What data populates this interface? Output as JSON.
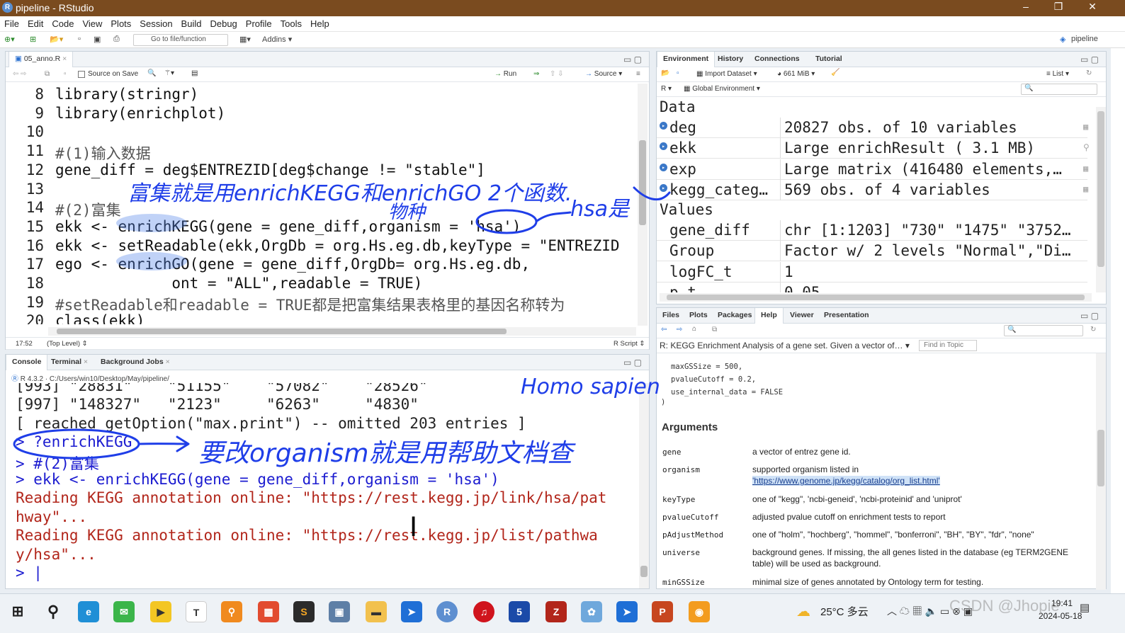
{
  "window": {
    "title": "pipeline - RStudio",
    "project": "pipeline"
  },
  "menu": [
    "File",
    "Edit",
    "Code",
    "View",
    "Plots",
    "Session",
    "Build",
    "Debug",
    "Profile",
    "Tools",
    "Help"
  ],
  "toolbar": {
    "goto_placeholder": "Go to file/function",
    "addins": "Addins"
  },
  "editor": {
    "tab": "05_anno.R",
    "source_on_save": "Source on Save",
    "run": "Run",
    "source": "Source",
    "lines": [
      {
        "n": "8",
        "text": "library(stringr)"
      },
      {
        "n": "9",
        "text": "library(enrichplot)"
      },
      {
        "n": "10",
        "text": ""
      },
      {
        "n": "11",
        "text": "#(1)输入数据"
      },
      {
        "n": "12",
        "text": "gene_diff = deg$ENTREZID[deg$change != \"stable\"]"
      },
      {
        "n": "13",
        "text": ""
      },
      {
        "n": "14",
        "text": "#(2)富集"
      },
      {
        "n": "15",
        "text": "ekk <- enrichKEGG(gene = gene_diff,organism = 'hsa')"
      },
      {
        "n": "16",
        "text": "ekk <- setReadable(ekk,OrgDb = org.Hs.eg.db,keyType = \"ENTREZID"
      },
      {
        "n": "17",
        "text": "ego <- enrichGO(gene = gene_diff,OrgDb= org.Hs.eg.db,"
      },
      {
        "n": "18",
        "text": "             ont = \"ALL\",readable = TRUE)"
      },
      {
        "n": "19",
        "text": "#setReadable和readable = TRUE都是把富集结果表格里的基因名称转为"
      },
      {
        "n": "20",
        "text": "class(ekk)"
      },
      {
        "n": "21",
        "text": ""
      }
    ],
    "status_pos": "17:52",
    "status_scope": "(Top Level)",
    "status_type": "R Script"
  },
  "console": {
    "tabs": [
      "Console",
      "Terminal",
      "Background Jobs"
    ],
    "path": "R 4.3.2 · C:/Users/win10/Desktop/May/pipeline/",
    "lines": [
      {
        "cls": "",
        "text": "[993] \"28831\"    \"51155\"    \"57082\"    \"28526\""
      },
      {
        "cls": "",
        "text": "[997] \"148327\"   \"2123\"     \"6263\"     \"4830\""
      },
      {
        "cls": "",
        "text": "[ reached getOption(\"max.print\") -- omitted 203 entries ]"
      },
      {
        "cls": "blue",
        "text": "> ?enrichKEGG"
      },
      {
        "cls": "blue",
        "text": "> #(2)富集"
      },
      {
        "cls": "blue",
        "text": "> ekk <- enrichKEGG(gene = gene_diff,organism = 'hsa')"
      },
      {
        "cls": "red",
        "text": "Reading KEGG annotation online: \"https://rest.kegg.jp/link/hsa/pat"
      },
      {
        "cls": "red",
        "text": "hway\"..."
      },
      {
        "cls": "red",
        "text": "Reading KEGG annotation online: \"https://rest.kegg.jp/list/pathwa"
      },
      {
        "cls": "red",
        "text": "y/hsa\"..."
      },
      {
        "cls": "blue",
        "text": "> |"
      }
    ]
  },
  "environment": {
    "tabs": [
      "Environment",
      "History",
      "Connections",
      "Tutorial"
    ],
    "import": "Import Dataset",
    "memory": "661 MiB",
    "list": "List",
    "lang": "R",
    "scope": "Global Environment",
    "data_header": "Data",
    "values_header": "Values",
    "data": [
      {
        "name": "deg",
        "value": "20827 obs. of 10 variables"
      },
      {
        "name": "ekk",
        "value": "Large enrichResult ( 3.1 MB)"
      },
      {
        "name": "exp",
        "value": "Large matrix (416480 elements,…"
      },
      {
        "name": "kegg_categ…",
        "value": "569 obs. of 4 variables"
      }
    ],
    "values": [
      {
        "name": "gene_diff",
        "value": "chr [1:1203] \"730\" \"1475\" \"3752…"
      },
      {
        "name": "Group",
        "value": "Factor w/ 2 levels \"Normal\",\"Di…"
      },
      {
        "name": "logFC_t",
        "value": "1"
      },
      {
        "name": "p_t",
        "value": "0.05"
      }
    ]
  },
  "help": {
    "tabs": [
      "Files",
      "Plots",
      "Packages",
      "Help",
      "Viewer",
      "Presentation"
    ],
    "topic": "R: KEGG Enrichment Analysis of a gene set. Given a vector of…",
    "find_placeholder": "Find in Topic",
    "usage": [
      "maxGSSize = 500,",
      "pvalueCutoff = 0.2,",
      "use_internal_data = FALSE",
      ")"
    ],
    "arguments_title": "Arguments",
    "args": [
      {
        "name": "gene",
        "desc": "a vector of entrez gene id."
      },
      {
        "name": "organism",
        "desc": "supported organism listed in",
        "link": "'https://www.genome.jp/kegg/catalog/org_list.html'"
      },
      {
        "name": "keyType",
        "desc": "one of \"kegg\", 'ncbi-geneid', 'ncbi-proteinid' and 'uniprot'"
      },
      {
        "name": "pvalueCutoff",
        "desc": "adjusted pvalue cutoff on enrichment tests to report"
      },
      {
        "name": "pAdjustMethod",
        "desc": "one of \"holm\", \"hochberg\", \"hommel\", \"bonferroni\", \"BH\", \"BY\", \"fdr\", \"none\""
      },
      {
        "name": "universe",
        "desc": "background genes. If missing, the all genes listed in the database (eg TERM2GENE table) will be used as background."
      },
      {
        "name": "minGSSize",
        "desc": "minimal size of genes annotated by Ontology term for testing."
      }
    ]
  },
  "annotations": {
    "note1": "富集就是用enrichKEGG和enrichGO 2个函数.",
    "note2": "物种",
    "note3": "hsa是",
    "note4": "Homo sapien",
    "note5": "要改organism就是用帮助文档查"
  },
  "taskbar": {
    "weather": "25°C 多云",
    "time": "19:41",
    "date": "2024-05-18",
    "watermark": "CSDN @Jhopie"
  }
}
